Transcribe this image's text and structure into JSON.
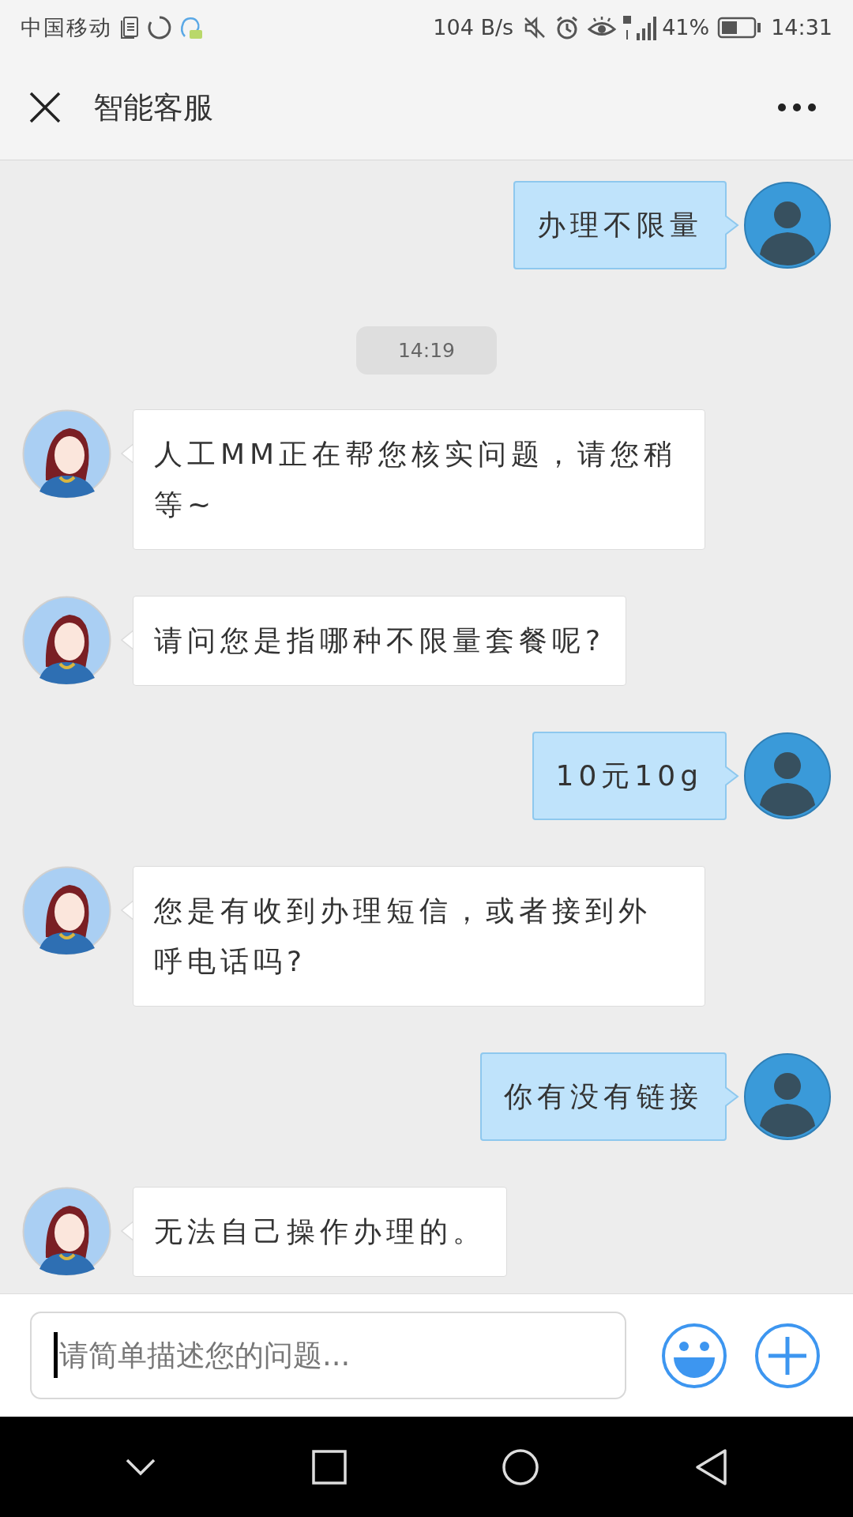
{
  "status_bar": {
    "carrier": "中国移动",
    "speed": "104 B/s",
    "battery": "41%",
    "time": "14:31"
  },
  "header": {
    "title": "智能客服"
  },
  "messages": [
    {
      "kind": "user",
      "text": "办理不限量"
    },
    {
      "kind": "time",
      "text": "14:19"
    },
    {
      "kind": "bot",
      "text": "人工MM正在帮您核实问题，请您稍等~"
    },
    {
      "kind": "bot",
      "text": "请问您是指哪种不限量套餐呢?"
    },
    {
      "kind": "user",
      "text": "10元10g"
    },
    {
      "kind": "bot",
      "text": "您是有收到办理短信，或者接到外呼电话吗?"
    },
    {
      "kind": "user",
      "text": "你有没有链接"
    },
    {
      "kind": "bot",
      "text": "无法自己操作办理的。"
    }
  ],
  "composer": {
    "placeholder": "请简单描述您的问题..."
  }
}
